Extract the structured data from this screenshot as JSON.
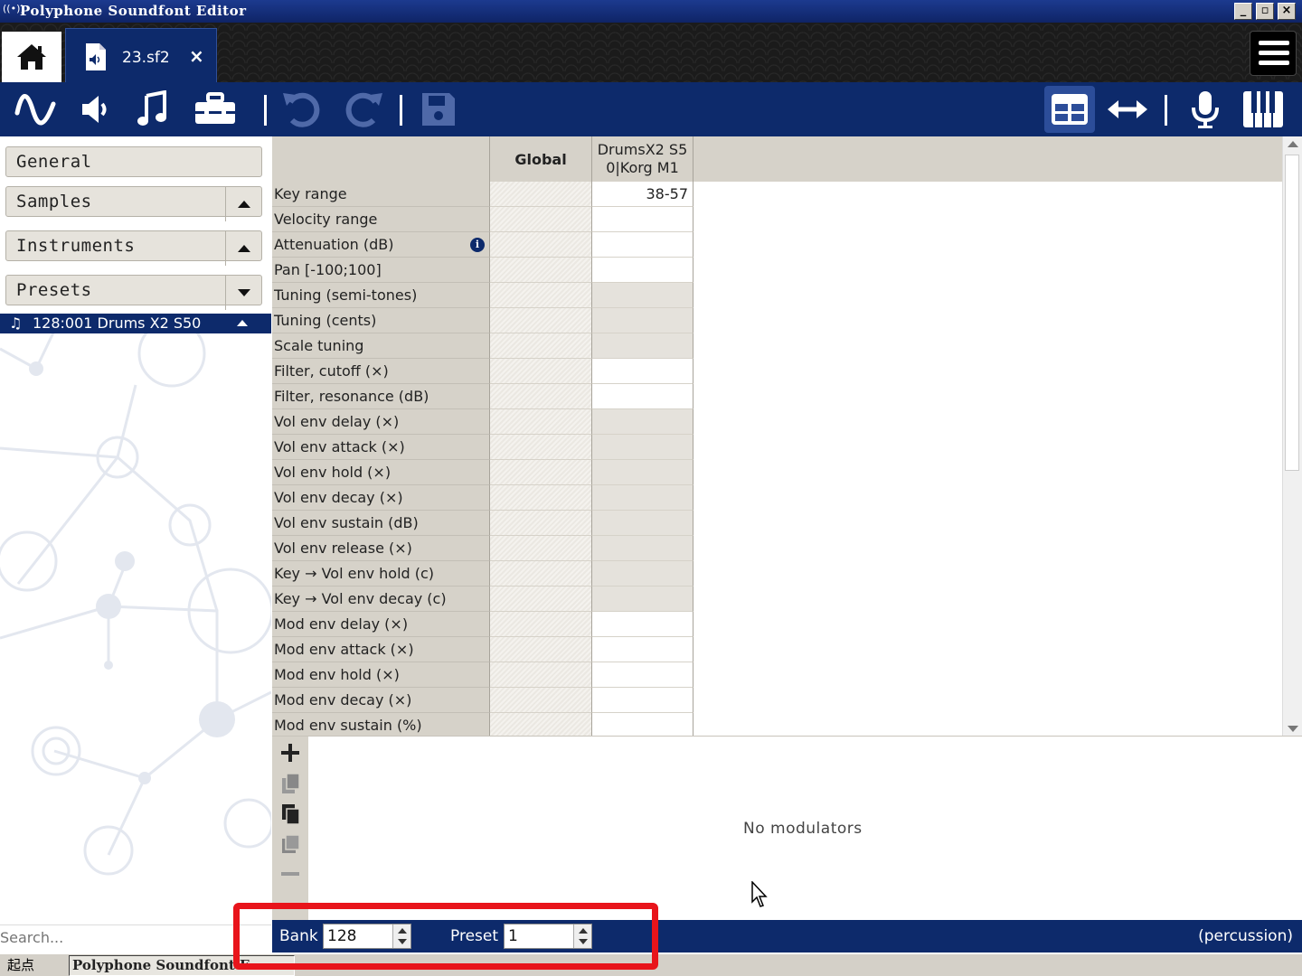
{
  "window": {
    "title": "Polyphone Soundfont Editor"
  },
  "tabs": {
    "file_tab": {
      "label": "23.sf2",
      "close": "×"
    }
  },
  "toolbar": {
    "left_icons": [
      "wave-icon",
      "speaker-icon",
      "music-note-icon",
      "toolbox-icon",
      "undo-icon",
      "redo-icon",
      "save-icon"
    ],
    "right_icons": [
      "table-view-icon",
      "horizontal-arrows-icon",
      "microphone-icon",
      "piano-keys-icon"
    ]
  },
  "sidebar": {
    "sections": [
      {
        "label": "General"
      },
      {
        "label": "Samples"
      },
      {
        "label": "Instruments"
      },
      {
        "label": "Presets"
      }
    ],
    "selected_item": "128:001 Drums X2 S50",
    "search_placeholder": "Search..."
  },
  "table": {
    "headers": {
      "global": "Global",
      "instrument_line1": "DrumsX2 S5",
      "instrument_line2": "0|Korg M1"
    },
    "rows": [
      {
        "label": "Key range",
        "value": "38-57"
      },
      {
        "label": "Velocity range",
        "value": ""
      },
      {
        "label": "Attenuation (dB)",
        "value": ""
      },
      {
        "label": "Pan [-100;100]",
        "value": ""
      },
      {
        "label": "Tuning (semi-tones)",
        "value": ""
      },
      {
        "label": "Tuning (cents)",
        "value": ""
      },
      {
        "label": "Scale tuning",
        "value": ""
      },
      {
        "label": "Filter, cutoff (×)",
        "value": ""
      },
      {
        "label": "Filter, resonance (dB)",
        "value": ""
      },
      {
        "label": "Vol env delay (×)",
        "value": ""
      },
      {
        "label": "Vol env attack (×)",
        "value": ""
      },
      {
        "label": "Vol env hold (×)",
        "value": ""
      },
      {
        "label": "Vol env decay (×)",
        "value": ""
      },
      {
        "label": "Vol env sustain (dB)",
        "value": ""
      },
      {
        "label": "Vol env release (×)",
        "value": ""
      },
      {
        "label": "Key → Vol env hold (c)",
        "value": ""
      },
      {
        "label": "Key → Vol env decay (c)",
        "value": ""
      },
      {
        "label": "Mod env delay (×)",
        "value": ""
      },
      {
        "label": "Mod env attack (×)",
        "value": ""
      },
      {
        "label": "Mod env hold (×)",
        "value": ""
      },
      {
        "label": "Mod env decay (×)",
        "value": ""
      },
      {
        "label": "Mod env sustain (%)",
        "value": ""
      }
    ]
  },
  "modulators": {
    "empty_text": "No modulators",
    "tool_icons": [
      "plus-icon",
      "copy-icon",
      "paste-icon",
      "duplicate-icon",
      "minus-icon"
    ]
  },
  "bottom_bar": {
    "bank_label": "Bank",
    "bank_value": "128",
    "preset_label": "Preset",
    "preset_value": "1",
    "status": "(percussion)"
  },
  "taskbar": {
    "start_label": "起点",
    "task_label": "Polyphone Soundfont E..."
  },
  "colors": {
    "primary": "#0d2a6b",
    "highlight": "#e8141b",
    "panel": "#d6d2c9"
  }
}
